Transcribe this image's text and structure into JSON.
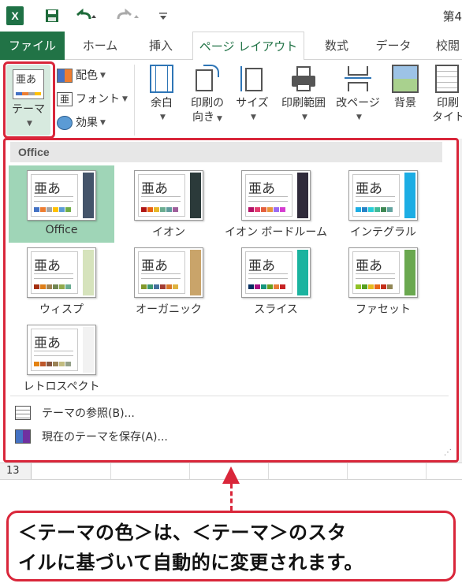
{
  "title_bar": {
    "app_badge": "X",
    "title_fragment": "第4"
  },
  "tabs": [
    {
      "label": "ファイル",
      "x": 0
    },
    {
      "label": "ホーム"
    },
    {
      "label": "挿入"
    },
    {
      "label": "ページ レイアウト"
    },
    {
      "label": "数式"
    },
    {
      "label": "データ"
    },
    {
      "label": "校閲"
    }
  ],
  "ribbon": {
    "theme_button": {
      "label": "テーマ",
      "glyph": "亜あ"
    },
    "colors": "配色",
    "fonts": "フォント",
    "effects": "効果",
    "margins": "余白",
    "orientation_1": "印刷の",
    "orientation_2": "向き",
    "size": "サイズ",
    "print_area": "印刷範囲",
    "breaks": "改ページ",
    "background": "背景",
    "print_titles_1": "印刷",
    "print_titles_2": "タイト"
  },
  "gallery": {
    "section_header": "Office",
    "themes": [
      {
        "name": "Office",
        "glyph": "亜あ",
        "accent": "#44546a",
        "swatches": [
          "#4472c4",
          "#ed7d31",
          "#a5a5a5",
          "#ffc000",
          "#5b9bd5",
          "#70ad47"
        ]
      },
      {
        "name": "イオン",
        "glyph": "亜あ",
        "accent": "#2b3a3a",
        "swatches": [
          "#b01513",
          "#ea6312",
          "#e6b729",
          "#6aac90",
          "#5f9c9d",
          "#9e5e9b"
        ]
      },
      {
        "name": "イオン ボードルーム",
        "glyph": "亜あ",
        "accent": "#2f2a3a",
        "swatches": [
          "#b31166",
          "#e33d6f",
          "#e45f3c",
          "#e9943a",
          "#9b6bf2",
          "#d53dd0"
        ]
      },
      {
        "name": "インテグラル",
        "glyph": "亜あ",
        "accent": "#1cade4",
        "swatches": [
          "#1cade4",
          "#2683c6",
          "#27ced7",
          "#42ba97",
          "#3e8853",
          "#62a39f"
        ]
      },
      {
        "name": "ウィスプ",
        "glyph": "亜あ",
        "accent": "#d6e3bc",
        "swatches": [
          "#a53010",
          "#de7e18",
          "#9f8351",
          "#728653",
          "#92aa4c",
          "#6aac91"
        ]
      },
      {
        "name": "オーガニック",
        "glyph": "亜あ",
        "accent": "#c9a46a",
        "swatches": [
          "#83992a",
          "#3c9770",
          "#44709d",
          "#a23c33",
          "#d97828",
          "#deb340"
        ]
      },
      {
        "name": "スライス",
        "glyph": "亜あ",
        "accent": "#1ab39f",
        "swatches": [
          "#052f61",
          "#a50e82",
          "#14967c",
          "#6a9e1f",
          "#e87d37",
          "#c62324"
        ]
      },
      {
        "name": "ファセット",
        "glyph": "亜あ",
        "accent": "#6aa84f",
        "swatches": [
          "#90c226",
          "#54a021",
          "#e6b91e",
          "#e76618",
          "#c42f1a",
          "#918655"
        ]
      },
      {
        "name": "レトロスペクト",
        "glyph": "亜あ",
        "accent": "#f2f2f2",
        "swatches": [
          "#e48312",
          "#bd582c",
          "#865640",
          "#9b8357",
          "#c2bc80",
          "#94a088"
        ]
      }
    ],
    "browse": "テーマの参照(B)...",
    "save": "現在のテーマを保存(A)..."
  },
  "sheet": {
    "row_number": "13"
  },
  "callout": {
    "line1": "＜テーマの色＞は、＜テーマ＞のスタ",
    "line2": "イルに基づいて自動的に変更されます。"
  },
  "colors": {
    "excel_green": "#217346",
    "highlight_red": "#d9263a",
    "selected_theme": "#9fd5b7"
  }
}
